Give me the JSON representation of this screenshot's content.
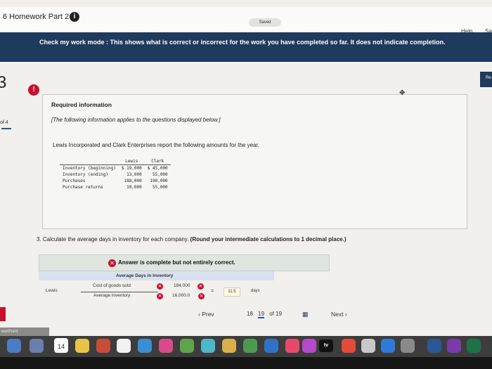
{
  "header": {
    "title": "6 Homework Part 2",
    "saved_label": "Saved",
    "help_label": "Help",
    "save_exit_label": "Sa"
  },
  "banner": {
    "text": "Check my work mode : This shows what is correct or incorrect for the work you have completed so far. It does not indicate completion."
  },
  "question_nav": {
    "number": "3",
    "of_label": "of 4",
    "right_button": "Re"
  },
  "required_info": {
    "heading": "Required information",
    "note": "[The following information applies to the questions displayed below.]",
    "intro": "Lewis Incorporated and Clark Enterprises report the following amounts for the year."
  },
  "amounts_table": {
    "columns": [
      "Lewis",
      "Clark"
    ],
    "rows": [
      {
        "label": "Inventory (beginning)",
        "lewis": "$ 19,000",
        "clark": "$ 45,000"
      },
      {
        "label": "Inventory (ending)",
        "lewis": "13,000",
        "clark": "55,000"
      },
      {
        "label": "Purchases",
        "lewis": "188,000",
        "clark": "190,000"
      },
      {
        "label": "Purchase returns",
        "lewis": "10,000",
        "clark": "55,000"
      }
    ]
  },
  "question": {
    "text": "3. Calculate the average days in inventory for each company.",
    "bold_text": "(Round your intermediate calculations to 1 decimal place.)"
  },
  "answer": {
    "status": "Answer is complete but not entirely correct.",
    "table_header": "Average Days in Inventory",
    "row_label": "Lewis",
    "numerator_label": "Cost of goods sold",
    "denominator_label": "Average inventory",
    "numerator_value": "184,000",
    "denominator_value": "16,000.0",
    "equals": "=",
    "result": "11.5",
    "unit": "days"
  },
  "pagination": {
    "prev_label": "Prev",
    "pages": [
      "18",
      "19"
    ],
    "current": "19",
    "of_label": "of 19",
    "next_label": "Next"
  },
  "taskbar": {
    "powerpoint_label": "werPoint",
    "calendar_day": "14",
    "tv_label": "tv"
  },
  "colors": {
    "banner": "#1e3a5c",
    "error": "#c8102e",
    "header_bg": "#d9e1f0"
  }
}
